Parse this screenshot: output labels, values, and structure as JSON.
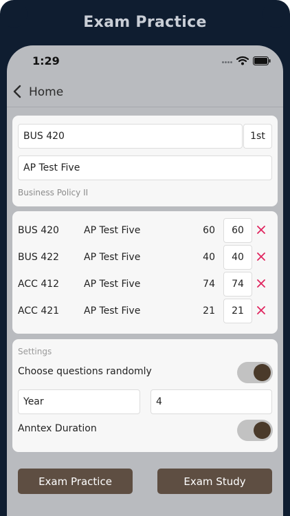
{
  "caption": "Exam Practice",
  "status": {
    "time": "1:29"
  },
  "nav": {
    "back_label": "Home"
  },
  "exam_form": {
    "course_code": "BUS 420",
    "semester": "1st",
    "test_name": "AP Test Five",
    "course_title": "Business Policy II"
  },
  "exam_list": [
    {
      "code": "BUS 420",
      "name": "AP Test Five",
      "value": "60",
      "input": "60"
    },
    {
      "code": "BUS 422",
      "name": "AP Test Five",
      "value": "40",
      "input": "40"
    },
    {
      "code": "ACC 412",
      "name": "AP Test Five",
      "value": "74",
      "input": "74"
    },
    {
      "code": "ACC 421",
      "name": "AP Test Five",
      "value": "21",
      "input": "21"
    }
  ],
  "settings": {
    "section_label": "Settings",
    "random_label": "Choose questions randomly",
    "random_on": true,
    "year_label": "Year",
    "year_value": "4",
    "duration_label": "Anntex Duration",
    "duration_on": true
  },
  "buttons": {
    "practice": "Exam Practice",
    "study": "Exam Study"
  },
  "colors": {
    "background": "#0f1d30",
    "accent": "#5e4e42",
    "remove": "#e0245e",
    "toggle_knob": "#4a3a2a"
  }
}
